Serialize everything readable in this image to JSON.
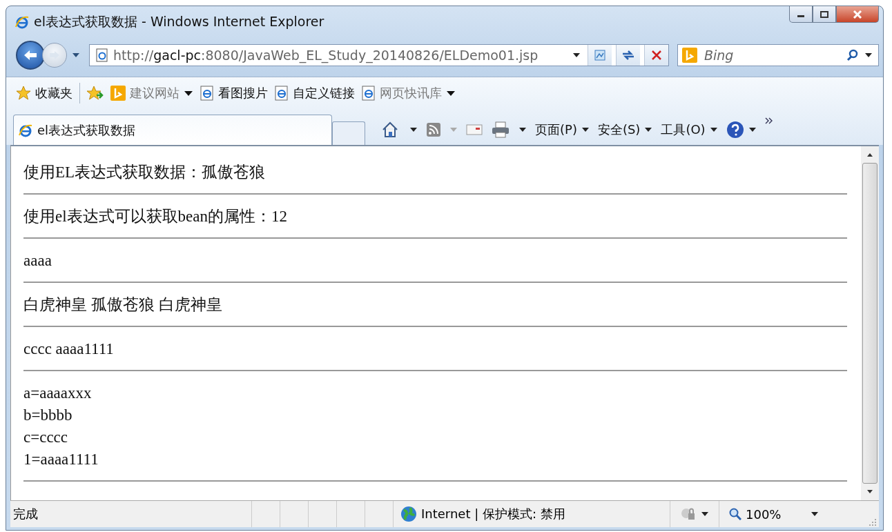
{
  "window": {
    "title": "el表达式获取数据 - Windows Internet Explorer"
  },
  "address_bar": {
    "url": "http://**gacl-pc**:8080/JavaWeb_EL_Study_20140826/ELDemo01.jsp"
  },
  "search": {
    "placeholder": "Bing"
  },
  "favorites_bar": {
    "label": "收藏夹",
    "items": [
      {
        "label": "建议网站",
        "kind": "bing",
        "dropdown": true,
        "disabled": true
      },
      {
        "label": "看图搜片",
        "kind": "ie",
        "dropdown": false,
        "disabled": false
      },
      {
        "label": "自定义链接",
        "kind": "ie",
        "dropdown": false,
        "disabled": false
      },
      {
        "label": "网页快讯库",
        "kind": "ie",
        "dropdown": true,
        "disabled": true
      }
    ]
  },
  "tabs": [
    {
      "label": "el表达式获取数据",
      "selected": true
    }
  ],
  "command_bar": {
    "menus": [
      "页面(P)",
      "安全(S)",
      "工具(O)"
    ]
  },
  "content": {
    "blocks": [
      {
        "lines": [
          "使用EL表达式获取数据：孤傲苍狼"
        ]
      },
      {
        "lines": [
          "使用el表达式可以获取bean的属性：12"
        ]
      },
      {
        "lines": [
          "aaaa"
        ]
      },
      {
        "lines": [
          "白虎神皇  孤傲苍狼  白虎神皇"
        ]
      },
      {
        "lines": [
          "cccc aaaa1111"
        ]
      },
      {
        "lines": [
          "a=aaaaxxx",
          "b=bbbb",
          "c=cccc",
          "1=aaaa1111"
        ]
      }
    ]
  },
  "status_bar": {
    "text": "完成",
    "zone": "Internet | 保护模式: 禁用",
    "zoom": "100%"
  }
}
